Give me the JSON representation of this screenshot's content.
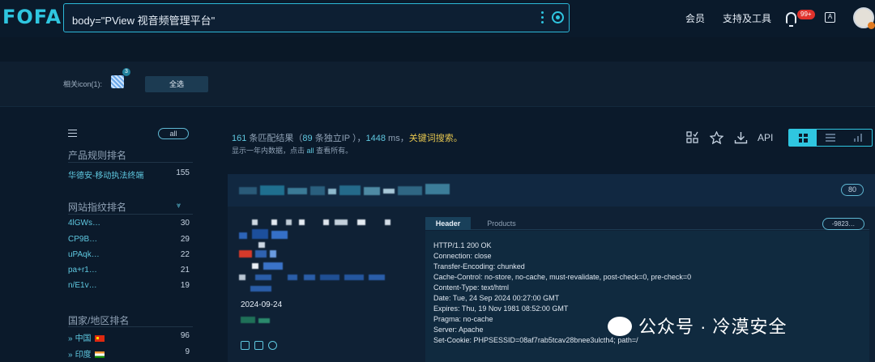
{
  "header": {
    "logo": "FOFA",
    "query": "body=\"PView 视音频管理平台\"",
    "nav": [
      "会员",
      "支持及工具"
    ],
    "notif_badge": "99+",
    "translate_glyph": "A"
  },
  "icon_filter": {
    "label": "相关icon(1):",
    "badge": "3",
    "select_all": "全选"
  },
  "sidebar": {
    "all_pill": "all",
    "product": {
      "title": "产品规则排名",
      "items": [
        {
          "k": "华德安-移动执法终端",
          "v": "155"
        }
      ]
    },
    "fingerprint": {
      "title": "网站指纹排名",
      "items": [
        {
          "k": "4lGWs…",
          "v": "30"
        },
        {
          "k": "CP9B…",
          "v": "29"
        },
        {
          "k": "uPAqk…",
          "v": "22"
        },
        {
          "k": "pa+r1…",
          "v": "21"
        },
        {
          "k": "n/E1v…",
          "v": "19"
        }
      ]
    },
    "country": {
      "title": "国家/地区排名",
      "items": [
        {
          "k": "中国",
          "v": "96"
        },
        {
          "k": "印度",
          "v": "9"
        }
      ]
    }
  },
  "summary": {
    "count": "161",
    "count_suffix": " 条匹配结果（",
    "ip": "89",
    "ip_suffix": " 条独立IP ），",
    "ms": "1448",
    "ms_suffix": " ms，",
    "keyword": "关键词搜索。",
    "sub_prefix": "显示一年内数据，点击",
    "sub_link": "all",
    "sub_suffix": "查看所有。"
  },
  "toolbar": {
    "api_label": "API"
  },
  "result": {
    "port": "80",
    "date": "2024-09-24",
    "tab_header": "Header",
    "tab_products": "Products",
    "hash": "-9823…",
    "headers": [
      "HTTP/1.1 200 OK",
      "Connection: close",
      "Transfer-Encoding: chunked",
      "Cache-Control: no-store, no-cache, must-revalidate, post-check=0, pre-check=0",
      "Content-Type: text/html",
      "Date: Tue, 24 Sep 2024 00:27:00 GMT",
      "Expires: Thu, 19 Nov 1981 08:52:00 GMT",
      "Pragma: no-cache",
      "Server: Apache",
      "Set-Cookie: PHPSESSID=08af7rab5tcav28bnee3ulcth4; path=/"
    ]
  },
  "watermark": "公众号 · 冷漠安全",
  "colors": {
    "accent": "#2fc6e0",
    "keyword": "#e6c64f",
    "badge": "#e0322c",
    "bg": "#0b1a2b"
  }
}
